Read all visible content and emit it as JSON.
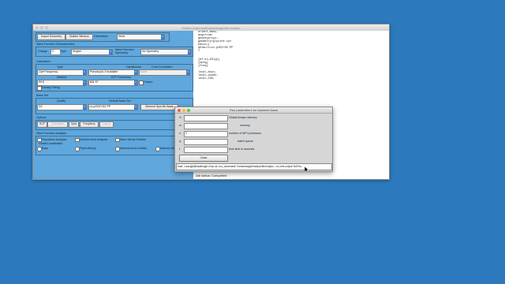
{
  "window": {
    "title": "Molden-Daemon/Example/glycine.molden",
    "toolbar": {
      "import_geometry": "Import Geometry",
      "builder_window": "Builder Window",
      "orientation_label": "Orientation",
      "orientation_value": "None"
    },
    "wavefunction": {
      "section": "Wave Function Characteristics",
      "charge_label": "Charge",
      "charge_value": "0",
      "spin_label": "Spin",
      "spin_value": "Singlet",
      "symmetry_label": "Wave Function Symmetry",
      "symmetry_value": "No Symmetry"
    },
    "calculation": {
      "section": "Calculation",
      "type_label": "Type",
      "type_value": "Opt+Frequency",
      "hamiltonian_label": "Hamiltonian",
      "hamiltonian_value": "Pseudopot, if available",
      "core_label": "Core-Correlation",
      "core_value": "None",
      "method_label": "Method",
      "method_value": "RKS",
      "dft_label": "DFT Functional",
      "dft_value": "B3LYP",
      "cosmo_label": "Cosmo",
      "density_fitting_label": "Density Fitting"
    },
    "basis": {
      "section": "Basis Set",
      "quality_label": "Quality",
      "quality_value": "DZ",
      "default_label": "Default Basis Set",
      "default_value": "cc-pVDZ+DZ-PP",
      "element_button": "Element Specific Basis"
    },
    "options": {
      "section": "Options",
      "buttons": [
        "SCF",
        "Correlation",
        "Opts",
        "FreqHess",
        "Cosmo"
      ]
    },
    "analysis": {
      "section": "Wave Function Analysis",
      "population": "Population Analysis",
      "intrinsic_analysis": "Intrinsic bond analysis",
      "save_vo": "Save Virtual Orbitals",
      "global_localization": "Global Localization",
      "boys": "Boys",
      "pipek": "Pipek-Mezey",
      "ibo": "Intrinsic bond orbitals",
      "natural": "Natural orbitals"
    },
    "editor_lines": [
      "orient,mass;",
      "angstrom;",
      "geomtyp=xyz;",
      "geometry=glycine.xyz",
      "basis={",
      "default=cc-pVDZ+DZ-PP",
      "}",
      "",
      "",
      "{df-ks,b3lyp}",
      "{optg}",
      "{freq}",
      "",
      "local,boys;",
      "local,pipek;",
      "local,ibo;"
    ],
    "status": "Job status: Completed"
  },
  "dialog": {
    "title": "Run parameters for backend hawk",
    "rows": [
      {
        "key": "G",
        "value": "",
        "label": "Global Arrays memory"
      },
      {
        "key": "m",
        "value": "",
        "label": "memory"
      },
      {
        "key": "n",
        "value": "2",
        "label": "number of MPI processes"
      },
      {
        "key": "q",
        "value": "",
        "label": "batch queue"
      },
      {
        "key": "t",
        "value": "",
        "label": "time limit in seconds"
      }
    ],
    "close_button": "Close",
    "host_line": "host: c.sacpjb@hawklogin.cf.ac.uk; run_command: /home/sacpjb/molpro/bin/molpro --no-xml-output %d/%s..."
  },
  "colors": {
    "desktop": "#2d79be",
    "panel": "#5fa7dc",
    "select_arrow": "#3b7fd3",
    "close_dot": "#ee5f57",
    "min_dot": "#f5bd30",
    "max_dot": "#5ec93b"
  }
}
